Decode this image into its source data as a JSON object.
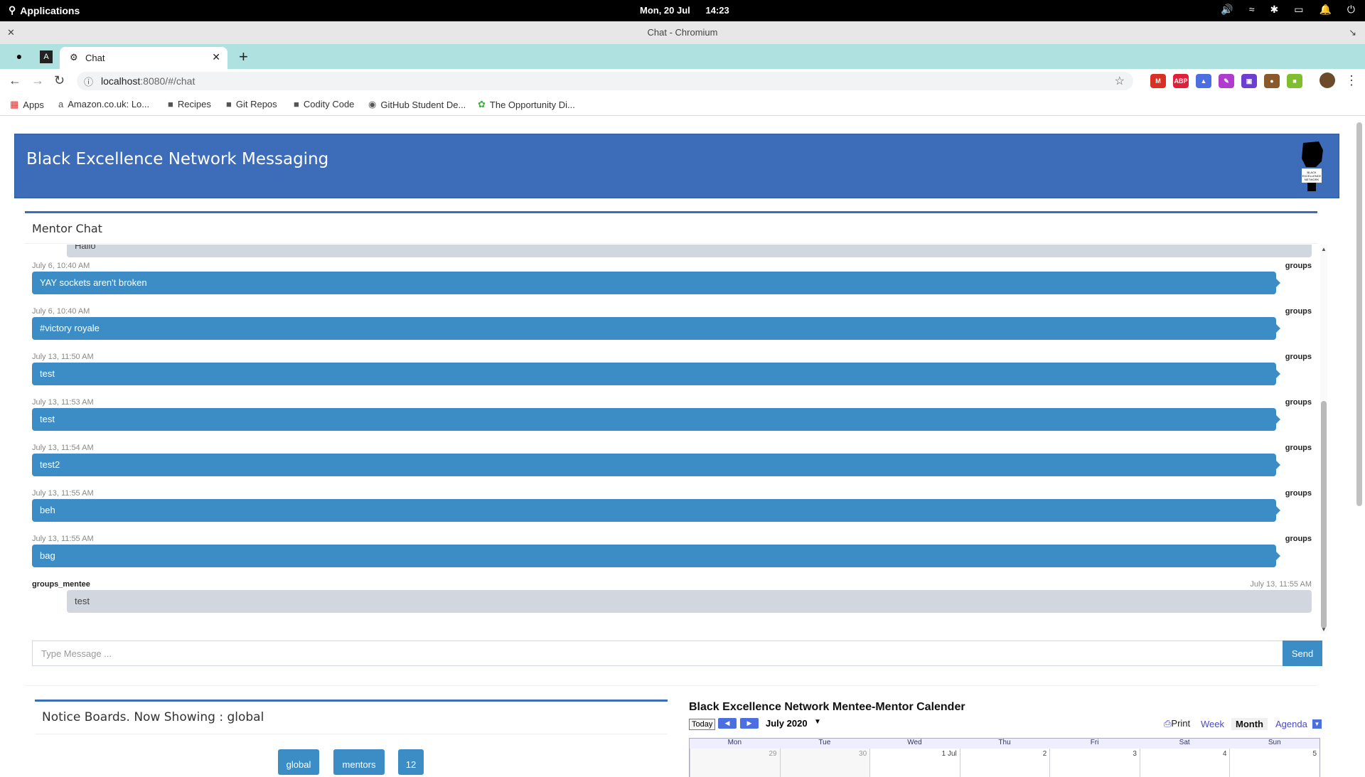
{
  "os_bar": {
    "applications_label": "Applications",
    "date": "Mon, 20 Jul",
    "time": "14:23",
    "tray_icons": [
      "volume-icon",
      "wifi-icon",
      "bluetooth-icon",
      "battery-icon",
      "notification-icon",
      "power-icon"
    ]
  },
  "window": {
    "title": "Chat - Chromium"
  },
  "browser": {
    "tab_title": "Chat",
    "url_host": "localhost",
    "url_rest": ":8080/#/chat",
    "extensions": [
      {
        "name": "gmail-ext",
        "label": "M",
        "color": "#d93025"
      },
      {
        "name": "adblock-ext",
        "label": "ABP",
        "color": "#e0203a"
      },
      {
        "name": "cap-ext",
        "label": "▲",
        "color": "#4b6fe0"
      },
      {
        "name": "pen-ext",
        "label": "✎",
        "color": "#b03ccf"
      },
      {
        "name": "twitch-ext",
        "label": "▣",
        "color": "#6d3fd0"
      },
      {
        "name": "cookie-ext",
        "label": "●",
        "color": "#8a5a2b"
      },
      {
        "name": "green-ext",
        "label": "■",
        "color": "#7fbf2f"
      }
    ],
    "bookmarks": [
      {
        "name": "bookmark-apps",
        "label": "Apps",
        "icon": "grid-icon"
      },
      {
        "name": "bookmark-amazon",
        "label": "Amazon.co.uk: Lo...",
        "icon": "amazon-icon"
      },
      {
        "name": "bookmark-recipes",
        "label": "Recipes",
        "icon": "folder-icon"
      },
      {
        "name": "bookmark-git-repos",
        "label": "Git Repos",
        "icon": "folder-icon"
      },
      {
        "name": "bookmark-codity",
        "label": "Codity Code",
        "icon": "folder-icon"
      },
      {
        "name": "bookmark-github",
        "label": "GitHub Student De...",
        "icon": "github-icon"
      },
      {
        "name": "bookmark-opportunity",
        "label": "The Opportunity Di...",
        "icon": "leaf-icon"
      }
    ]
  },
  "page": {
    "banner_title": "Black Excellence Network Messaging",
    "logo_text": "BLACK EXCELLENCE NETWORK",
    "chat": {
      "header": "Mentor Chat",
      "partial_top_message": "Hallo",
      "messages": [
        {
          "time": "July 6, 10:40 AM",
          "sender": "groups",
          "text": "YAY sockets aren't broken",
          "side": "right"
        },
        {
          "time": "July 6, 10:40 AM",
          "sender": "groups",
          "text": "#victory royale",
          "side": "right"
        },
        {
          "time": "July 13, 11:50 AM",
          "sender": "groups",
          "text": "test",
          "side": "right"
        },
        {
          "time": "July 13, 11:53 AM",
          "sender": "groups",
          "text": "test",
          "side": "right"
        },
        {
          "time": "July 13, 11:54 AM",
          "sender": "groups",
          "text": "test2",
          "side": "right"
        },
        {
          "time": "July 13, 11:55 AM",
          "sender": "groups",
          "text": "beh",
          "side": "right"
        },
        {
          "time": "July 13, 11:55 AM",
          "sender": "groups",
          "text": "bag",
          "side": "right"
        },
        {
          "time": "July 13, 11:55 AM",
          "sender": "groups_mentee",
          "text": "test",
          "side": "left"
        }
      ],
      "input_placeholder": "Type Message ...",
      "send_label": "Send"
    },
    "notice": {
      "title": "Notice Boards. Now Showing : global",
      "buttons": [
        "global",
        "mentors",
        "12"
      ]
    },
    "calendar": {
      "title": "Black Excellence Network Mentee-Mentor Calender",
      "today_label": "Today",
      "month_label": "July 2020",
      "print_label": "Print",
      "views": [
        "Week",
        "Month",
        "Agenda"
      ],
      "active_view": "Month",
      "weekdays": [
        "Mon",
        "Tue",
        "Wed",
        "Thu",
        "Fri",
        "Sat",
        "Sun"
      ],
      "first_week": [
        "29",
        "30",
        "1 Jul",
        "2",
        "3",
        "4",
        "5"
      ]
    }
  }
}
